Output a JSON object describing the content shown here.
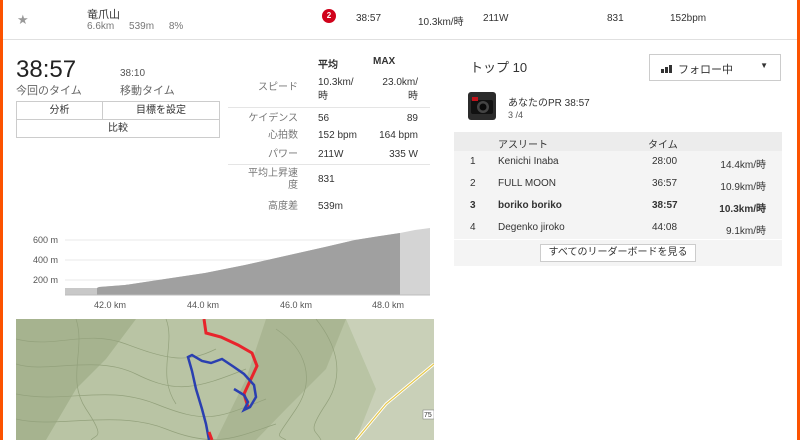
{
  "segment": {
    "star_icon": "star-icon",
    "name": "竜爪山",
    "distance": "6.6km",
    "elevation": "539m",
    "grade": "8%",
    "rank": "2",
    "time": "38:57",
    "speed": "10.3km/時",
    "power": "211W",
    "vam": "831",
    "heart_rate": "152bpm"
  },
  "summary": {
    "elapsed_time": "38:57",
    "elapsed_label": "今回のタイム",
    "moving_time": "38:10",
    "moving_label": "移動タイム",
    "analyze_button": "分析",
    "goal_button": "目標を設定",
    "compare_button": "比較"
  },
  "stats": {
    "avg_header": "平均",
    "max_header": "MAX",
    "rows": [
      {
        "label": "スピード",
        "avg_line1": "10.3km/",
        "avg_line2": "時",
        "max_line1": "23.0km/",
        "max_line2": "時"
      },
      {
        "label": "ケイデンス",
        "avg": "56",
        "max": "89"
      },
      {
        "label": "心拍数",
        "avg": "152 bpm",
        "max": "164 bpm"
      },
      {
        "label": "パワー",
        "avg": "211W",
        "max": "335 W"
      },
      {
        "label_line1": "平均上昇速",
        "label_line2": "度",
        "avg": "831"
      },
      {
        "label": "高度差",
        "avg": "539m"
      }
    ]
  },
  "elevation_chart": {
    "y_ticks": [
      "600 m",
      "400 m",
      "200 m"
    ],
    "x_ticks": [
      "42.0 km",
      "44.0 km",
      "46.0 km",
      "48.0 km"
    ]
  },
  "top10": {
    "title": "トップ 10",
    "follow_label": "フォロー中",
    "pr_title": "あなたのPR 38:57",
    "pr_sub": "3 /4",
    "col_athlete": "アスリート",
    "col_time": "タイム",
    "rows": [
      {
        "rank": "1",
        "name": "Kenichi Inaba",
        "time": "28:00",
        "speed": "14.4km/時"
      },
      {
        "rank": "2",
        "name": "FULL MOON",
        "time": "36:57",
        "speed": "10.9km/時"
      },
      {
        "rank": "3",
        "name": "boriko boriko",
        "time": "38:57",
        "speed": "10.3km/時"
      },
      {
        "rank": "4",
        "name": "Degenko jiroko",
        "time": "44:08",
        "speed": "9.1km/時"
      }
    ],
    "view_all": "すべてのリーダーボードを見る"
  },
  "map": {
    "road_label": "75",
    "colors": {
      "route_red": "#e8242b",
      "route_blue": "#2a3fb0"
    }
  },
  "colors": {
    "brand": "#fc5200",
    "badge": "#d0021b"
  }
}
